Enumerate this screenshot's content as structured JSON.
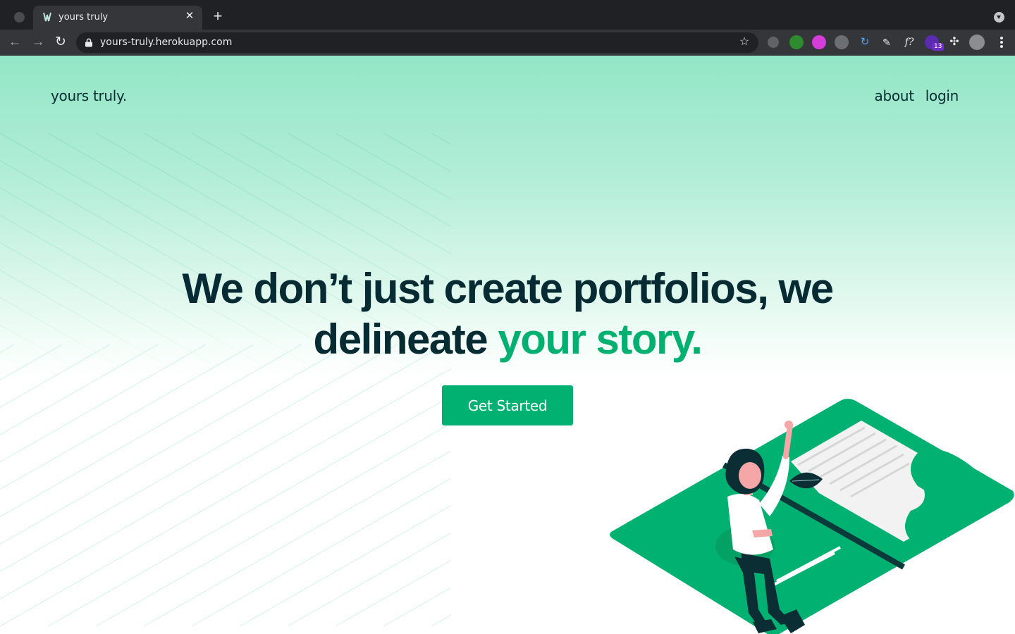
{
  "browser": {
    "tab_title": "yours truly",
    "url": "yours-truly.herokuapp.com",
    "extension_badge": "13",
    "icons": {
      "back": "arrow-left-icon",
      "forward": "arrow-right-icon",
      "reload": "reload-icon",
      "lock": "lock-icon",
      "star": "star-icon",
      "new_tab": "plus-icon",
      "close_tab": "close-icon",
      "menu": "kebab-menu-icon"
    }
  },
  "header": {
    "brand": "yours truly.",
    "nav": [
      {
        "label": "about"
      },
      {
        "label": "login"
      }
    ]
  },
  "hero": {
    "headline_line1": "We don’t just create portfolios, we",
    "headline_line2_prefix": "delineate ",
    "headline_line2_accent": "your story.",
    "cta_label": "Get Started"
  },
  "colors": {
    "brand_green": "#00b172",
    "dark_text": "#072b33",
    "accent_text": "#00b070",
    "hero_gradient_top": "#92e6c6"
  }
}
